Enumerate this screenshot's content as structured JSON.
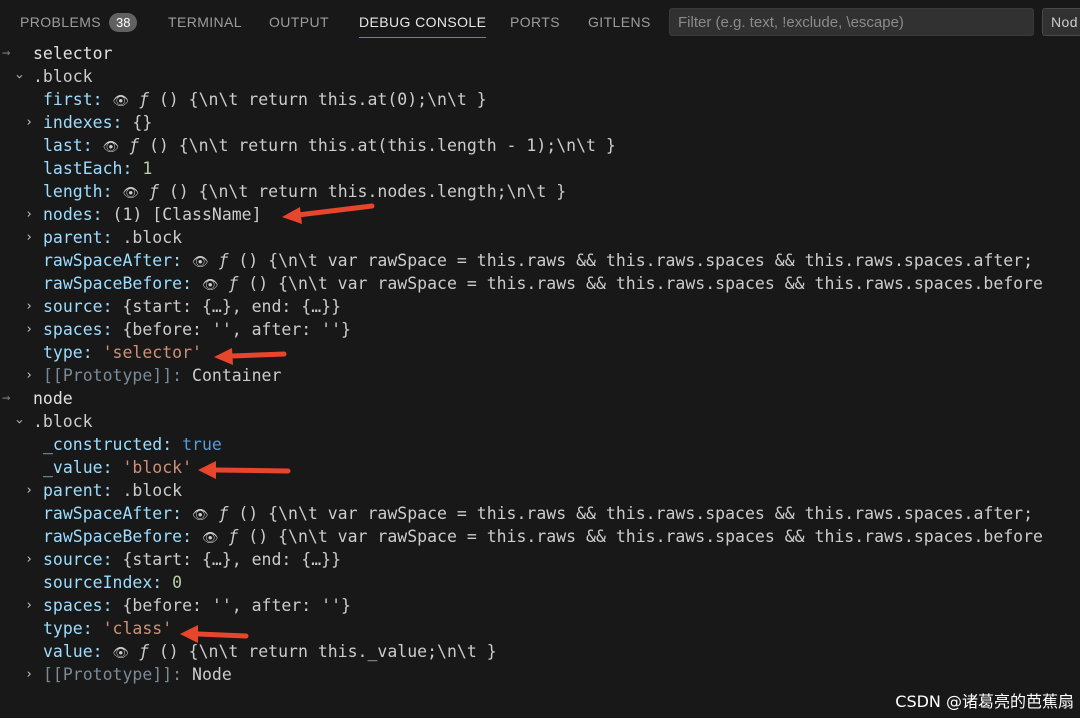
{
  "panel": {
    "tabs": [
      {
        "label": "PROBLEMS",
        "badge": "38"
      },
      {
        "label": "TERMINAL"
      },
      {
        "label": "OUTPUT"
      },
      {
        "label": "DEBUG CONSOLE"
      },
      {
        "label": "PORTS"
      },
      {
        "label": "GITLENS"
      }
    ],
    "active_tab": "DEBUG CONSOLE",
    "filter_placeholder": "Filter (e.g. text, !exclude, \\escape)",
    "dropdown_value": "Nod"
  },
  "console": {
    "selector_header": "selector",
    "selector_block": ".block",
    "selector_props": [
      {
        "key": "first:",
        "eye": "👁",
        "fn": "ƒ",
        "body": "() {\\n\\t      return this.at(0);\\n\\t    }"
      },
      {
        "key": "indexes:",
        "value": "{}"
      },
      {
        "key": "last:",
        "eye": "👁",
        "fn": "ƒ",
        "body": "() {\\n\\t      return this.at(this.length - 1);\\n\\t    }"
      },
      {
        "key": "lastEach:",
        "value": "1"
      },
      {
        "key": "length:",
        "eye": "👁",
        "fn": "ƒ",
        "body": "() {\\n\\t      return this.nodes.length;\\n\\t    }"
      },
      {
        "key": "nodes:",
        "value": "(1) [ClassName]"
      },
      {
        "key": "parent:",
        "value": ".block"
      },
      {
        "key": "rawSpaceAfter:",
        "eye": "👁",
        "fn": "ƒ",
        "body": "() {\\n\\t      var rawSpace = this.raws && this.raws.spaces && this.raws.spaces.after;"
      },
      {
        "key": "rawSpaceBefore:",
        "eye": "👁",
        "fn": "ƒ",
        "body": "() {\\n\\t      var rawSpace = this.raws && this.raws.spaces && this.raws.spaces.before"
      },
      {
        "key": "source:",
        "value": "{start: {…}, end: {…}}"
      },
      {
        "key": "spaces:",
        "value": "{before: '', after: ''}"
      },
      {
        "key": "type:",
        "value": "'selector'"
      },
      {
        "key": "[[Prototype]]:",
        "value": "Container"
      }
    ],
    "node_header": "node",
    "node_block": ".block",
    "node_props": [
      {
        "key": "_constructed:",
        "value": "true"
      },
      {
        "key": "_value:",
        "value": "'block'"
      },
      {
        "key": "parent:",
        "value": ".block"
      },
      {
        "key": "rawSpaceAfter:",
        "eye": "👁",
        "fn": "ƒ",
        "body": "() {\\n\\t      var rawSpace = this.raws && this.raws.spaces && this.raws.spaces.after;"
      },
      {
        "key": "rawSpaceBefore:",
        "eye": "👁",
        "fn": "ƒ",
        "body": "() {\\n\\t      var rawSpace = this.raws && this.raws.spaces && this.raws.spaces.before"
      },
      {
        "key": "source:",
        "value": "{start: {…}, end: {…}}"
      },
      {
        "key": "sourceIndex:",
        "value": "0"
      },
      {
        "key": "spaces:",
        "value": "{before: '', after: ''}"
      },
      {
        "key": "type:",
        "value": "'class'"
      },
      {
        "key": "value:",
        "eye": "👁",
        "fn": "ƒ",
        "body": "() {\\n\\t      return this._value;\\n\\t    }"
      },
      {
        "key": "[[Prototype]]:",
        "value": "Node"
      }
    ]
  },
  "watermark": "CSDN @诸葛亮的芭蕉扇",
  "colors": {
    "annotation_arrow": "#e8462c",
    "active_tab_underline": "#3c8ce7"
  }
}
